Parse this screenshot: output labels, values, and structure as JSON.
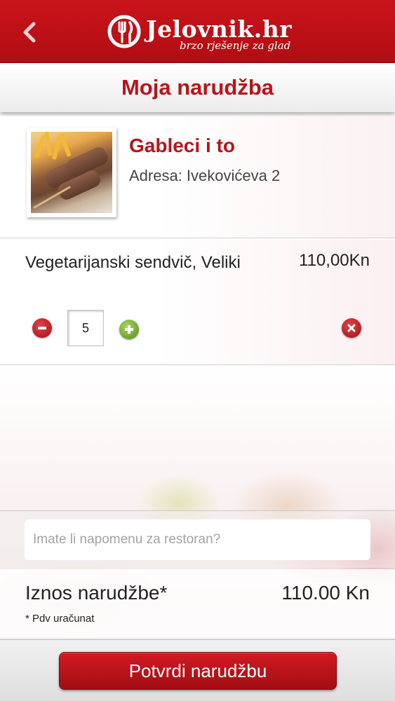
{
  "header": {
    "logo_name": "Jelovnik.hr",
    "logo_tagline": "brzo rješenje za glad"
  },
  "page": {
    "title": "Moja narudžba"
  },
  "restaurant": {
    "name": "Gableci i to",
    "address": "Adresa: Ivekovićeva 2"
  },
  "order_items": [
    {
      "name": "Vegetarijanski sendvič, Veliki",
      "price": "110,00Kn",
      "quantity": "5"
    }
  ],
  "notes": {
    "placeholder": "Imate li napomenu za restoran?"
  },
  "summary": {
    "total_label": "Iznos narudžbe*",
    "total_value": "110.00 Kn",
    "vat_note": "* Pdv uračunat"
  },
  "actions": {
    "confirm_label": "Potvrdi narudžbu"
  },
  "icons": {
    "back": "chevron-left-icon",
    "logo": "fork-knife-logo-icon",
    "decrease": "minus-circle-icon",
    "increase": "plus-circle-icon",
    "remove": "close-circle-icon"
  },
  "colors": {
    "brand_red": "#c9141b",
    "title_red": "#b8141b",
    "plus_green": "#4f8f1f"
  }
}
